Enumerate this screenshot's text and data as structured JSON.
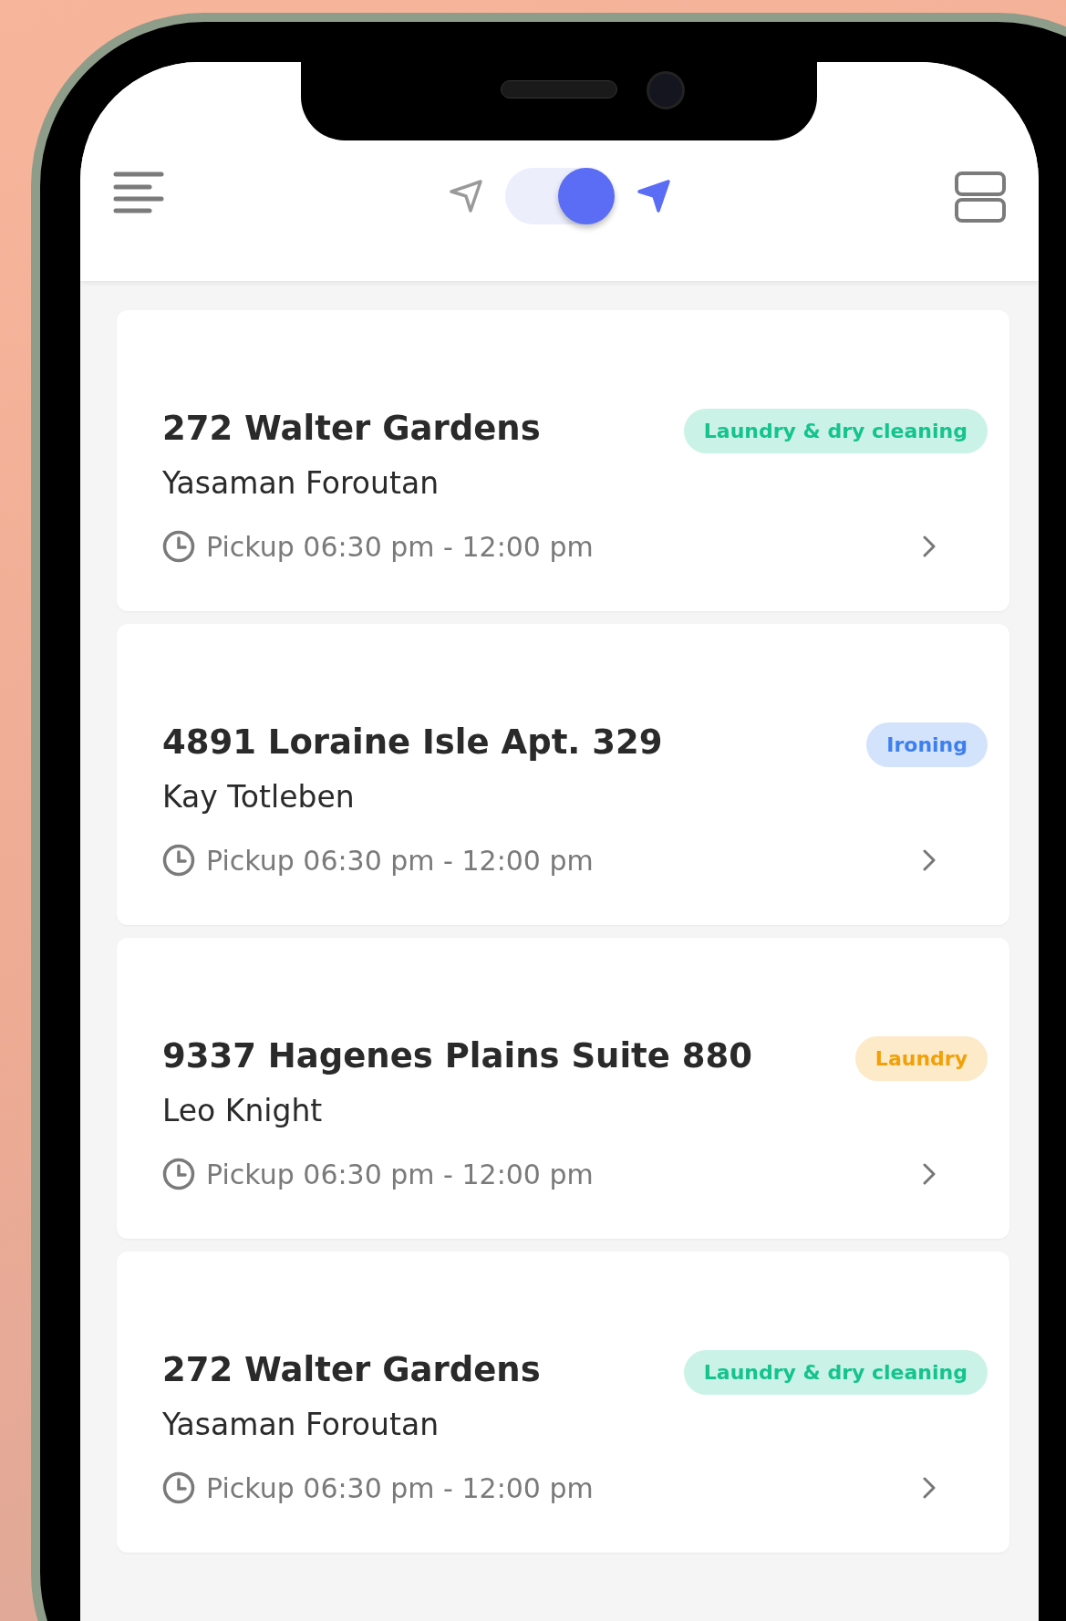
{
  "header": {
    "location_toggle": {
      "on": true
    }
  },
  "orders": [
    {
      "address": "272 Walter Gardens",
      "customer": "Yasaman Foroutan",
      "pickup": "Pickup 06:30 pm - 12:00 pm",
      "service": "Laundry & dry cleaning",
      "color": "#14c48c"
    },
    {
      "address": "4891 Loraine Isle Apt. 329",
      "customer": "Kay Totleben",
      "pickup": "Pickup 06:30 pm - 12:00 pm",
      "service": "Ironing",
      "color": "#3d7ff0"
    },
    {
      "address": "9337 Hagenes Plains Suite 880",
      "customer": "Leo Knight",
      "pickup": "Pickup 06:30 pm - 12:00 pm",
      "service": "Laundry",
      "color": "#f2a007"
    },
    {
      "address": "272 Walter Gardens",
      "customer": "Yasaman Foroutan",
      "pickup": "Pickup 06:30 pm - 12:00 pm",
      "service": "Laundry & dry cleaning",
      "color": "#14c48c"
    }
  ]
}
